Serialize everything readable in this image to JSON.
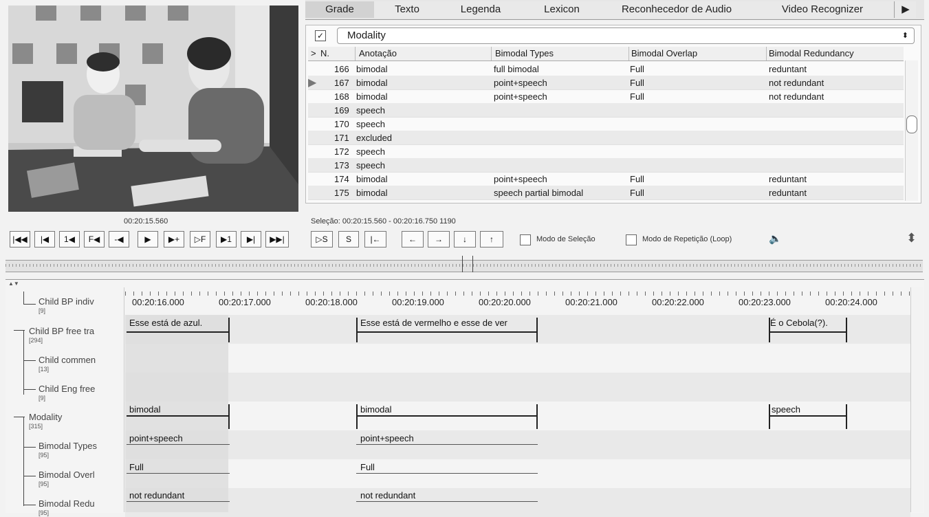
{
  "tabs": [
    "Grade",
    "Texto",
    "Legenda",
    "Lexicon",
    "Reconhecedor de Audio",
    "Video Recognizer"
  ],
  "tab_scroll_arrow": "▶",
  "video": {
    "time": "00:20:15.560"
  },
  "grid": {
    "tier_checkbox": "✓",
    "tier_selected": "Modality",
    "select_arrow": "⬍",
    "headers": {
      "marker": ">",
      "n": "N.",
      "annotation": "Anotação",
      "types": "Bimodal Types",
      "overlap": "Bimodal Overlap",
      "redundancy": "Bimodal Redundancy"
    },
    "rows": [
      {
        "n": "166",
        "annotation": "bimodal",
        "types": "full bimodal",
        "overlap": "Full",
        "redundancy": "reduntant"
      },
      {
        "n": "167",
        "annotation": "bimodal",
        "types": "point+speech",
        "overlap": "Full",
        "redundancy": "not redundant"
      },
      {
        "n": "168",
        "annotation": "bimodal",
        "types": "point+speech",
        "overlap": "Full",
        "redundancy": "not redundant"
      },
      {
        "n": "169",
        "annotation": "speech",
        "types": "",
        "overlap": "",
        "redundancy": ""
      },
      {
        "n": "170",
        "annotation": "speech",
        "types": "",
        "overlap": "",
        "redundancy": ""
      },
      {
        "n": "171",
        "annotation": "excluded",
        "types": "",
        "overlap": "",
        "redundancy": ""
      },
      {
        "n": "172",
        "annotation": "speech",
        "types": "",
        "overlap": "",
        "redundancy": ""
      },
      {
        "n": "173",
        "annotation": "speech",
        "types": "",
        "overlap": "",
        "redundancy": ""
      },
      {
        "n": "174",
        "annotation": "bimodal",
        "types": "point+speech",
        "overlap": "Full",
        "redundancy": "reduntant"
      },
      {
        "n": "175",
        "annotation": "bimodal",
        "types": "speech partial bimodal",
        "overlap": "Full",
        "redundancy": "reduntant"
      }
    ],
    "current_row_marker": "▶"
  },
  "selection": {
    "label": "Seleção: 00:20:15.560 - 00:20:16.750  1190"
  },
  "player_buttons": [
    "|◀◀",
    "|◀",
    "1◀",
    "F◀",
    "-◀",
    "▶",
    "▶+",
    "▷F",
    "▶1",
    "▶|",
    "▶▶|"
  ],
  "selection_buttons": [
    "▷S",
    "S",
    "|←"
  ],
  "nav_buttons": [
    "←",
    "→",
    "↓",
    "↑"
  ],
  "mode_selection": "Modo de Seleção",
  "mode_loop": "Modo de Repetição (Loop)",
  "volume_icon": "🔈",
  "resize_icon": "⬍",
  "timeline": {
    "collapse_icon": "▲▼",
    "ruler": [
      "00:20:16.000",
      "00:20:17.000",
      "00:20:18.000",
      "00:20:19.000",
      "00:20:20.000",
      "00:20:21.000",
      "00:20:22.000",
      "00:20:23.000",
      "00:20:24.000"
    ],
    "tiers": [
      {
        "name": "Child BP indiv",
        "count": "[9]"
      },
      {
        "name": "Child BP free tra",
        "count": "[294]"
      },
      {
        "name": "Child commen",
        "count": "[13]"
      },
      {
        "name": "Child Eng free",
        "count": "[9]"
      },
      {
        "name": "Modality",
        "count": "[315]"
      },
      {
        "name": "Bimodal Types",
        "count": "[95]"
      },
      {
        "name": "Bimodal Overl",
        "count": "[95]"
      },
      {
        "name": "Bimodal Redu",
        "count": "[95]"
      }
    ],
    "annotations": {
      "free_tra": [
        "Esse está de azul.",
        "Esse está de vermelho e esse de ver",
        "É o Cebola(?)."
      ],
      "modality": [
        "bimodal",
        "bimodal",
        "speech"
      ],
      "types": [
        "point+speech",
        "point+speech"
      ],
      "overlap": [
        "Full",
        "Full"
      ],
      "redundancy": [
        "not redundant",
        "not redundant"
      ]
    }
  }
}
